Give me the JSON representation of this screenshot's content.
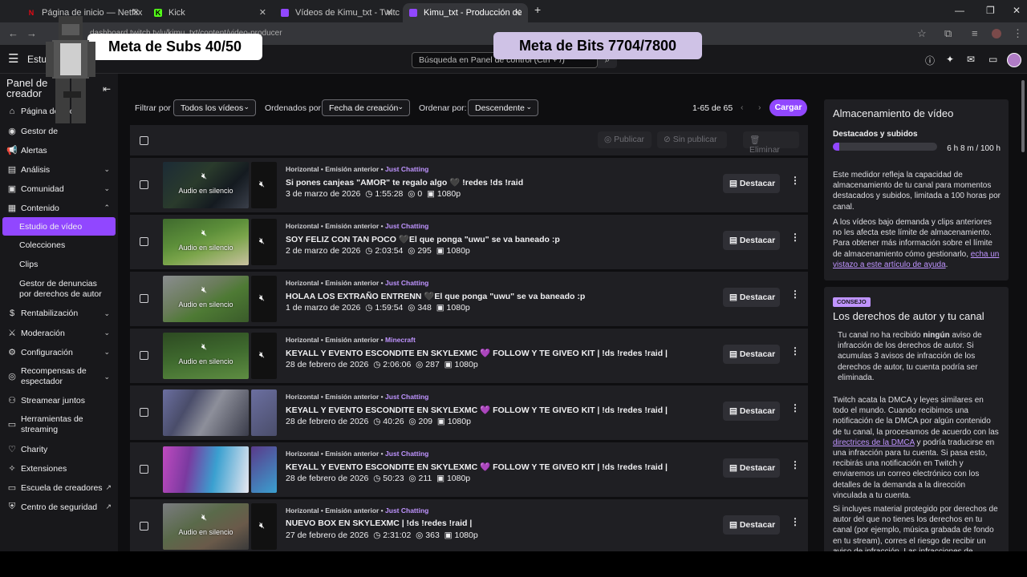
{
  "browser": {
    "tabs": [
      {
        "title": "Página de inicio — Netflix",
        "icon": "netflix-icon",
        "color": "#e50914",
        "glyph": "N"
      },
      {
        "title": "Kick",
        "icon": "kick-icon",
        "color": "#53fc18",
        "glyph": "K"
      },
      {
        "title": "Vídeos de Kimu_txt - Twitch",
        "icon": "twitch-icon",
        "color": "#9147ff",
        "glyph": "▮"
      },
      {
        "title": "Kimu_txt - Producción de vídeo",
        "icon": "twitch-icon",
        "color": "#9147ff",
        "glyph": "▮"
      }
    ],
    "url": "dashboard.twitch.tv/u/kimu_txt/content/video-producer"
  },
  "topnav": {
    "section": "Estu",
    "search_placeholder": "Búsqueda en Panel de control (Ctrl + /)"
  },
  "sidebar": {
    "title": "Panel de creador",
    "items": [
      {
        "label": "Página de inicio",
        "icon": "home-icon"
      },
      {
        "label": "Gestor de",
        "icon": "stream-manager-icon"
      },
      {
        "label": "Alertas",
        "icon": "megaphone-icon"
      },
      {
        "label": "Análisis",
        "icon": "chart-icon"
      },
      {
        "label": "Comunidad",
        "icon": "community-icon"
      },
      {
        "label": "Contenido",
        "icon": "content-icon"
      },
      {
        "label": "Estudio de vídeo",
        "icon": ""
      },
      {
        "label": "Colecciones",
        "icon": ""
      },
      {
        "label": "Clips",
        "icon": ""
      },
      {
        "label": "Gestor de denuncias por derechos de autor",
        "icon": ""
      },
      {
        "label": "Rentabilización",
        "icon": "money-icon"
      },
      {
        "label": "Moderación",
        "icon": "sword-icon"
      },
      {
        "label": "Configuración",
        "icon": "gear-icon"
      },
      {
        "label": "Recompensas de espectador",
        "icon": "reward-icon"
      },
      {
        "label": "Streamear juntos",
        "icon": "people-icon"
      },
      {
        "label": "Herramientas de streaming",
        "icon": "tools-icon"
      },
      {
        "label": "Charity",
        "icon": "heart-icon"
      },
      {
        "label": "Extensiones",
        "icon": "puzzle-icon"
      },
      {
        "label": "Escuela de creadores",
        "icon": "school-icon"
      },
      {
        "label": "Centro de seguridad",
        "icon": "shield-icon"
      }
    ]
  },
  "filters": {
    "filter_label": "Filtrar por",
    "filter_value": "Todos los vídeos",
    "sort_label": "Ordenados por",
    "sort_value": "Fecha de creación",
    "order_label": "Ordenar por:",
    "order_value": "Descendente",
    "pager": "1-65 de 65",
    "upload_button": "Cargar"
  },
  "list_header": {
    "publish": "Publicar",
    "unpublish": "Sin publicar",
    "delete": "Eliminar"
  },
  "videos": [
    {
      "meta": "Horizontal • Emisión anterior • ",
      "category": "Just Chatting",
      "title": "Si pones canjeas \"AMOR\" te regalo algo 🖤 !redes !ds !raid",
      "date": "3 de marzo de 2026",
      "duration": "1:55:28",
      "views": "0",
      "quality": "1080p",
      "muted": "Audio en silencio",
      "highlight": "Destacar"
    },
    {
      "meta": "Horizontal • Emisión anterior • ",
      "category": "Just Chatting",
      "title": "SOY FELIZ CON TAN POCO 🖤El que ponga \"uwu\" se va baneado :p",
      "date": "2 de marzo de 2026",
      "duration": "2:03:54",
      "views": "295",
      "quality": "1080p",
      "muted": "Audio en silencio",
      "highlight": "Destacar"
    },
    {
      "meta": "Horizontal • Emisión anterior • ",
      "category": "Just Chatting",
      "title": "HOLAA LOS EXTRAÑO ENTRENN 🖤El que ponga \"uwu\" se va baneado :p",
      "date": "1 de marzo de 2026",
      "duration": "1:59:54",
      "views": "348",
      "quality": "1080p",
      "muted": "Audio en silencio",
      "highlight": "Destacar"
    },
    {
      "meta": "Horizontal • Emisión anterior • ",
      "category": "Minecraft",
      "title": "KEYALL Y EVENTO ESCONDITE EN SKYLEXMC 💜 FOLLOW Y TE GIVEO KIT | !ds !redes !raid |",
      "date": "28 de febrero de 2026",
      "duration": "2:06:06",
      "views": "287",
      "quality": "1080p",
      "muted": "Audio en silencio",
      "highlight": "Destacar"
    },
    {
      "meta": "Horizontal • Emisión anterior • ",
      "category": "Just Chatting",
      "title": "KEYALL Y EVENTO ESCONDITE EN SKYLEXMC 💜 FOLLOW Y TE GIVEO KIT | !ds !redes !raid |",
      "date": "28 de febrero de 2026",
      "duration": "40:26",
      "views": "209",
      "quality": "1080p",
      "muted": "",
      "highlight": "Destacar"
    },
    {
      "meta": "Horizontal • Emisión anterior • ",
      "category": "Just Chatting",
      "title": "KEYALL Y EVENTO ESCONDITE EN SKYLEXMC 💜 FOLLOW Y TE GIVEO KIT | !ds !redes !raid |",
      "date": "28 de febrero de 2026",
      "duration": "50:23",
      "views": "211",
      "quality": "1080p",
      "muted": "",
      "highlight": "Destacar"
    },
    {
      "meta": "Horizontal • Emisión anterior • ",
      "category": "Just Chatting",
      "title": "NUEVO BOX EN SKYLEXMC | !ds !redes !raid |",
      "date": "27 de febrero de 2026",
      "duration": "2:31:02",
      "views": "363",
      "quality": "1080p",
      "muted": "Audio en silencio",
      "highlight": "Destacar"
    }
  ],
  "storage": {
    "title": "Almacenamiento de vídeo",
    "subtitle": "Destacados y subidos",
    "usage": "6 h 8 m / 100 h",
    "fill_fraction": 0.06,
    "desc1": "Este medidor refleja la capacidad de almacenamiento de tu canal para momentos destacados y subidos, limitada a 100 horas por canal.",
    "desc2_pre": "A los vídeos bajo demanda y clips anteriores no les afecta este límite de almacenamiento. Para obtener más información sobre el límite de almacenamiento cómo gestionarlo, ",
    "desc2_link": "echa un vistazo a este artículo de ayuda",
    "desc2_post": "."
  },
  "copyright": {
    "badge": "CONSEJO",
    "title": "Los derechos de autor y tu canal",
    "p1_pre": "Tu canal no ha recibido ",
    "p1_bold": "ningún",
    "p1_post": " aviso de infracción de los derechos de autor. Si acumulas 3 avisos de infracción de los derechos de autor, tu cuenta podría ser eliminada.",
    "p2_pre": "Twitch acata la DMCA y leyes similares en todo el mundo. Cuando recibimos una notificación de la DMCA por algún contenido de tu canal, la procesamos de acuerdo con las ",
    "p2_link": "directrices de la DMCA",
    "p2_post": " y podría traducirse en una infracción para tu cuenta. Si pasa esto, recibirás una notificación en Twitch y enviaremos un correo electrónico con los detalles de la demanda a la dirección vinculada a tu cuenta.",
    "p3": "Si incluyes material protegido por derechos de autor del que no tienes los derechos en tu canal (por ejemplo, música grabada de fondo en tu stream), corres el riesgo de recibir un aviso de infracción. Las infracciones de"
  },
  "overlays": {
    "subs_goal": "Meta de Subs  40/50",
    "bits_goal": "Meta de Bits  7704/7800"
  },
  "colors": {
    "accent": "#9147ff",
    "accent_light": "#bf94ff"
  }
}
